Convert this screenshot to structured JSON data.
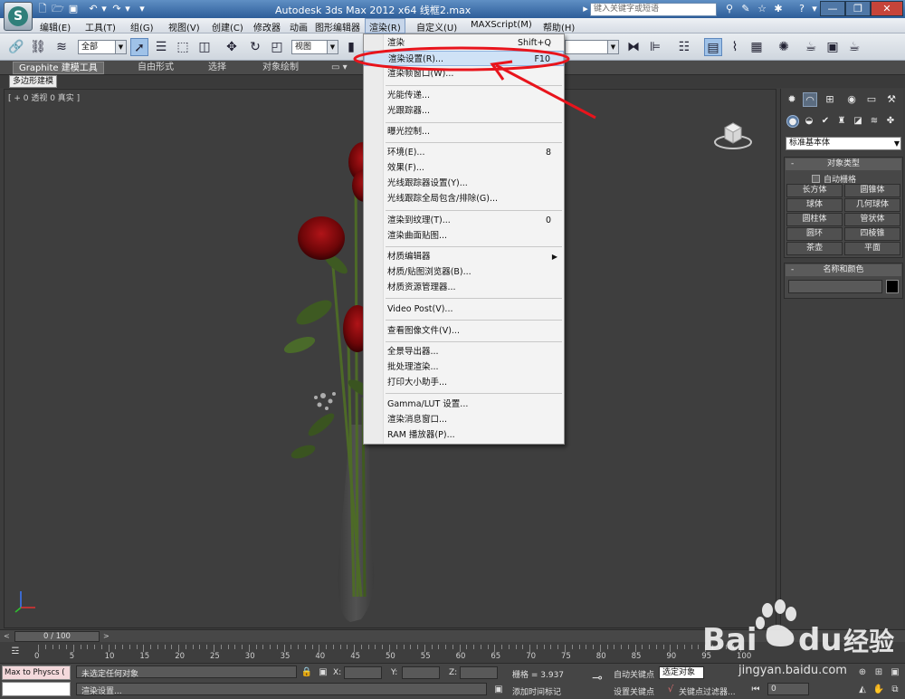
{
  "window": {
    "title": "Autodesk 3ds Max  2012 x64      线框2.max",
    "help_search_placeholder": "键入关键字或短语"
  },
  "menubar": {
    "items": [
      {
        "label": "编辑(E)"
      },
      {
        "label": "工具(T)"
      },
      {
        "label": "组(G)"
      },
      {
        "label": "视图(V)"
      },
      {
        "label": "创建(C)"
      },
      {
        "label": "修改器"
      },
      {
        "label": "动画"
      },
      {
        "label": "图形编辑器"
      },
      {
        "label": "渲染(R)"
      },
      {
        "label": "自定义(U)"
      },
      {
        "label": "MAXScript(M)"
      },
      {
        "label": "帮助(H)"
      }
    ]
  },
  "toolbar": {
    "selection_filter": "全部",
    "reference_coord": "视图"
  },
  "ribbon": {
    "tabs": [
      {
        "label": "Graphite 建模工具"
      },
      {
        "label": "自由形式"
      },
      {
        "label": "选择"
      },
      {
        "label": "对象绘制"
      }
    ],
    "subtab": "多边形建模"
  },
  "viewport": {
    "label": "[ + 0 透视 0 真实 ]"
  },
  "render_menu": {
    "items": [
      {
        "label": "渲染",
        "shortcut": "Shift+Q"
      },
      {
        "label": "渲染设置(R)...",
        "shortcut": "F10"
      },
      {
        "label": "渲染帧窗口(W)..."
      },
      {
        "label": "光能传递..."
      },
      {
        "label": "光跟踪器..."
      },
      {
        "label": "曝光控制..."
      },
      {
        "label": "环境(E)...",
        "shortcut": "8"
      },
      {
        "label": "效果(F)..."
      },
      {
        "label": "光线跟踪器设置(Y)..."
      },
      {
        "label": "光线跟踪全局包含/排除(G)..."
      },
      {
        "label": "渲染到纹理(T)...",
        "shortcut": "0"
      },
      {
        "label": "渲染曲面贴图..."
      },
      {
        "label": "材质编辑器",
        "submenu": "▶"
      },
      {
        "label": "材质/贴图浏览器(B)..."
      },
      {
        "label": "材质资源管理器..."
      },
      {
        "label": "Video Post(V)..."
      },
      {
        "label": "查看图像文件(V)..."
      },
      {
        "label": "全景导出器..."
      },
      {
        "label": "批处理渲染..."
      },
      {
        "label": "打印大小助手..."
      },
      {
        "label": "Gamma/LUT 设置..."
      },
      {
        "label": "渲染消息窗口..."
      },
      {
        "label": "RAM 播放器(P)..."
      }
    ]
  },
  "command_panel": {
    "category": "标准基本体",
    "object_type_title": "对象类型",
    "auto_grid": "自动栅格",
    "objects": [
      {
        "label": "长方体"
      },
      {
        "label": "圆锥体"
      },
      {
        "label": "球体"
      },
      {
        "label": "几何球体"
      },
      {
        "label": "圆柱体"
      },
      {
        "label": "管状体"
      },
      {
        "label": "圆环"
      },
      {
        "label": "四棱锥"
      },
      {
        "label": "茶壶"
      },
      {
        "label": "平面"
      }
    ],
    "name_color_title": "名称和颜色"
  },
  "timeline": {
    "slider": "0 / 100",
    "ticks": [
      "0",
      "5",
      "10",
      "15",
      "20",
      "25",
      "30",
      "35",
      "40",
      "45",
      "50",
      "55",
      "60",
      "65",
      "70",
      "75",
      "80",
      "85",
      "90",
      "95",
      "100"
    ]
  },
  "statusbar": {
    "listener": "Max to Physcs (",
    "status": "未选定任何对象",
    "prompt": "渲染设置...",
    "x_label": "X:",
    "y_label": "Y:",
    "z_label": "Z:",
    "grid": "栅格 = 3.937",
    "add_time_tag": "添加时间标记",
    "auto_key": "自动关键点",
    "set_key": "设置关键点",
    "selected": "选定对象",
    "key_filters": "关键点过滤器...",
    "frame": "0"
  },
  "watermark": {
    "brand": "Bai",
    "brand2": "du",
    "suffix": "经验",
    "url": "jingyan.baidu.com"
  },
  "colors": {
    "annotation": "#e8141c",
    "menu_highlight": "#cfe2f6"
  }
}
